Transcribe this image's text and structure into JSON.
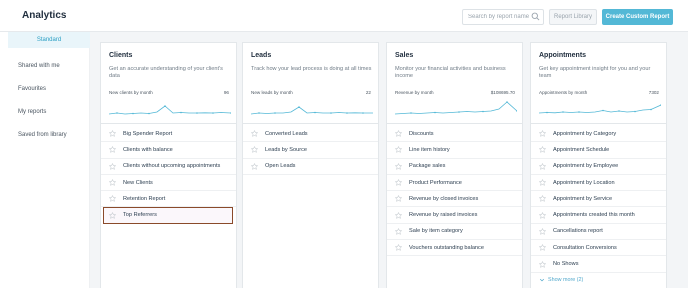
{
  "header": {
    "title": "Analytics",
    "search_placeholder": "Search by report name",
    "report_library_label": "Report Library",
    "create_custom_label": "Create Custom Report",
    "accent_color": "#53b8d6"
  },
  "sidebar": {
    "items": [
      {
        "label": "Standard",
        "active": true
      },
      {
        "label": "Shared with me"
      },
      {
        "label": "Favourites"
      },
      {
        "label": "My reports"
      },
      {
        "label": "Saved from library"
      }
    ]
  },
  "cards": [
    {
      "title": "Clients",
      "description": "Get an accurate understanding of your client's data",
      "spark_label": "New clients by month",
      "spark_value": "96",
      "items": [
        "Big Spender Report",
        "Clients with balance",
        "Clients without upcoming appointments",
        "New Clients",
        "Retention Report",
        "Top Referrers"
      ],
      "highlighted_item": "Top Referrers"
    },
    {
      "title": "Leads",
      "description": "Track how your lead process is doing at all times",
      "spark_label": "New leads by month",
      "spark_value": "22",
      "items": [
        "Converted Leads",
        "Leads by Source",
        "Open Leads"
      ]
    },
    {
      "title": "Sales",
      "description": "Monitor your financial activities and business income",
      "spark_label": "Revenue by month",
      "spark_value": "$108695.70",
      "items": [
        "Discounts",
        "Line item history",
        "Package sales",
        "Product Performance",
        "Revenue by closed invoices",
        "Revenue by raised invoices",
        "Sale by item category",
        "Vouchers outstanding balance"
      ]
    },
    {
      "title": "Appointments",
      "description": "Get key appointment insight for you and your team",
      "spark_label": "Appointments by month",
      "spark_value": "7302",
      "items": [
        "Appointment by Category",
        "Appointment Schedule",
        "Appointment by Employee",
        "Appointment by Location",
        "Appointment by Service",
        "Appointments created this month",
        "Cancellations report",
        "Consultation Conversions",
        "No Shows"
      ],
      "show_more": "Show more (2)"
    }
  ]
}
